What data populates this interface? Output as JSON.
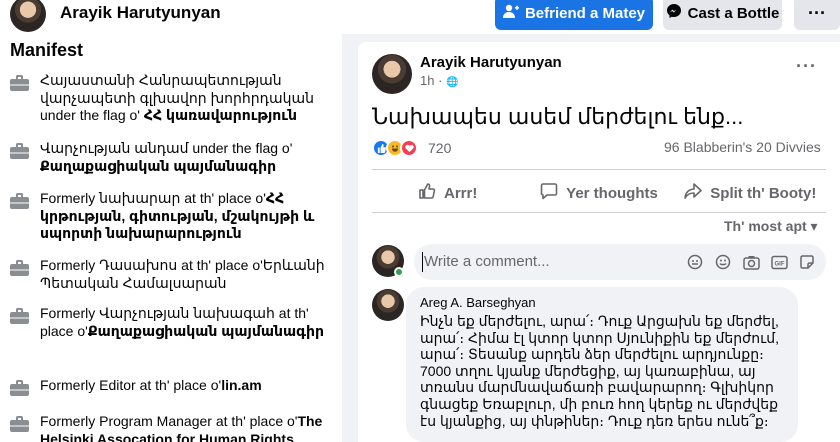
{
  "topbar": {
    "name": "Arayik Harutyunyan",
    "primary_button": "Befriend a Matey",
    "secondary_button": "Cast a Bottle",
    "more_button": "···"
  },
  "manifest": {
    "title": "Manifest",
    "items": [
      {
        "pre": "Հայաստանի Հանրապետության վարչապետի գլխավոր խորհրդական under the flag o' ",
        "bold": "ՀՀ կառավարություն"
      },
      {
        "pre": "Վարչության անդամ under the flag o' ",
        "bold": "Քաղաքացիական պայմանագիր"
      },
      {
        "pre": "Formerly նախարար at th' place o'",
        "bold": "ՀՀ կրթության, գիտության, մշակույթի և սպորտի նախարարություն"
      },
      {
        "pre": "Formerly Դասախոս at th' place o'Երևանի Պետական Համալսարան",
        "bold": ""
      },
      {
        "pre": "Formerly Վարչության նախագահ at th' place o'",
        "bold": "Քաղաքացիական պայմանագիր"
      },
      {
        "pre": "Formerly Editor at th' place o'",
        "bold": "lin.am"
      },
      {
        "pre": "Formerly Program Manager at th' place o'",
        "bold": "The Helsinki Assocation for Human Rights"
      }
    ]
  },
  "post": {
    "author": "Arayik Harutyunyan",
    "time": "1h · ",
    "globe": "🌐",
    "dots": "···",
    "text": "Նախապես ասեմ մերժելու ենք...",
    "reaction_count": "720",
    "stats": "96 Blabberin's  20 Divvies",
    "actions": {
      "like": "Arrr!",
      "comment": "Yer thoughts",
      "share": "Split th' Booty!"
    },
    "sort": "Th' most apt ▾",
    "write_placeholder": "Write a comment...",
    "comment": {
      "author": "Areg A. Barseghyan",
      "text": "Ինչն եք մերժելու, արա՛։ Դուք Արցախն եք մերժել, արա՛։ Հիմա էլ կտոր կտոր Սյունիքին եք մերժում, արա՛։ Տեսանք արդեն ձեր մերժելու արդյունքը։ 7000 տղու կյանք մերժեցիք, այ կառաբինա, այ տռանս մարմնավաճառի բավարարող։ Գլխիկոր գնացեք Եռաբլուր, մի բուռ հող կերեք ու մերժվեք էս կյանքից, այ փնթիներ։ Դուք դեռ երես ունե՞ք։"
    }
  },
  "colors": {
    "accent": "#1b74e4",
    "online": "#31a24c",
    "like": "#1877f2",
    "haha": "#f7b928",
    "love": "#f33e58"
  }
}
